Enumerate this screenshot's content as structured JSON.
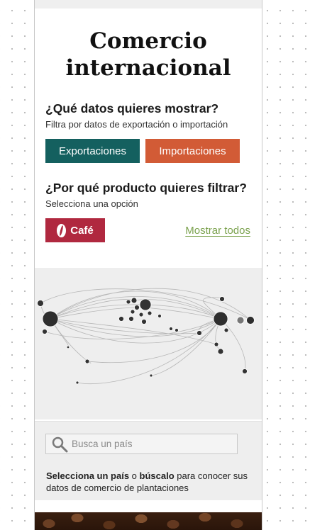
{
  "title_line1": "Comercio",
  "title_line2": "internacional",
  "data_section": {
    "question": "¿Qué datos quieres mostrar?",
    "subtitle": "Filtra por datos de exportación o importación",
    "buttons": {
      "export_label": "Exportaciones",
      "import_label": "Importaciones"
    }
  },
  "product_section": {
    "question": "¿Por qué producto quieres filtrar?",
    "subtitle": "Selecciona una opción",
    "product_button_label": "Café",
    "show_all_label": "Mostrar todos"
  },
  "search": {
    "placeholder": "Busca un país",
    "hint_bold1": "Selecciona un país",
    "hint_mid": " o ",
    "hint_bold2": "búscalo",
    "hint_rest": " para conocer sus datos de comercio de plantaciones"
  },
  "colors": {
    "export": "#14605f",
    "import": "#d25b36",
    "coffee": "#b0283f",
    "link": "#7ba24e"
  }
}
